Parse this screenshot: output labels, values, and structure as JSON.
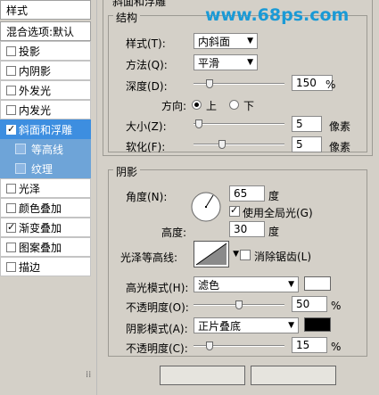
{
  "sidebar": {
    "header": "样式",
    "blend_options": "混合选项:默认",
    "items": [
      {
        "label": "投影",
        "checked": false
      },
      {
        "label": "内阴影",
        "checked": false
      },
      {
        "label": "外发光",
        "checked": false
      },
      {
        "label": "内发光",
        "checked": false
      },
      {
        "label": "斜面和浮雕",
        "checked": true
      },
      {
        "label": "等高线",
        "checked": false
      },
      {
        "label": "纹理",
        "checked": false
      },
      {
        "label": "光泽",
        "checked": false
      },
      {
        "label": "颜色叠加",
        "checked": false
      },
      {
        "label": "渐变叠加",
        "checked": true
      },
      {
        "label": "图案叠加",
        "checked": false
      },
      {
        "label": "描边",
        "checked": false
      }
    ]
  },
  "watermark": "www.68ps.com",
  "bevel": {
    "section_title": "斜面和浮雕",
    "structure_title": "结构",
    "style_label": "样式(T):",
    "style_value": "内斜面",
    "technique_label": "方法(Q):",
    "technique_value": "平滑",
    "depth_label": "深度(D):",
    "depth_value": "150",
    "depth_unit": "%",
    "depth_level": 0.15,
    "direction_label": "方向:",
    "dir_up": "上",
    "dir_down": "下",
    "direction_selected": "上",
    "size_label": "大小(Z):",
    "size_value": "5",
    "size_unit": "像素",
    "size_level": 0.02,
    "soften_label": "软化(F):",
    "soften_value": "5",
    "soften_unit": "像素",
    "soften_level": 0.3
  },
  "shading": {
    "title": "阴影",
    "angle_label": "角度(N):",
    "angle_value": "65",
    "angle_unit": "度",
    "global_light_label": "使用全局光(G)",
    "global_light_checked": true,
    "altitude_label": "高度:",
    "altitude_value": "30",
    "altitude_unit": "度",
    "gloss_label": "光泽等高线:",
    "antialias_label": "消除锯齿(L)",
    "antialias_checked": false,
    "highlight_mode_label": "高光模式(H):",
    "highlight_mode_value": "滤色",
    "highlight_color": "#ffffff",
    "highlight_opacity_label": "不透明度(O):",
    "highlight_opacity_value": "50",
    "highlight_opacity_unit": "%",
    "highlight_opacity_level": 0.5,
    "shadow_mode_label": "阴影模式(A):",
    "shadow_mode_value": "正片叠底",
    "shadow_color": "#000000",
    "shadow_opacity_label": "不透明度(C):",
    "shadow_opacity_value": "15",
    "shadow_opacity_unit": "%",
    "shadow_opacity_level": 0.15
  }
}
